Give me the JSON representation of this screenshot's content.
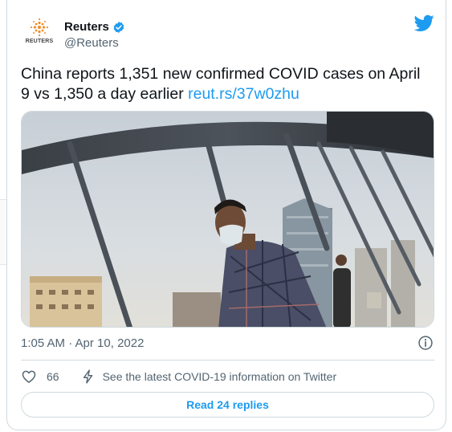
{
  "author": {
    "display_name": "Reuters",
    "handle": "@Reuters",
    "avatar_text": "REUTERS",
    "verified_icon": "verified-badge-icon"
  },
  "tweet": {
    "text": "China reports 1,351 new confirmed COVID cases on April 9 vs 1,350 a day earlier ",
    "link": "reut.rs/37w0zhu",
    "timestamp": "1:05 AM · Apr 10, 2022"
  },
  "actions": {
    "like_count": "66",
    "covid_info": "See the latest COVID-19 information on Twitter"
  },
  "replies": {
    "button_label": "Read 24 replies"
  },
  "colors": {
    "accent": "#1d9bf0",
    "reuters_orange": "#f28c28",
    "secondary_text": "#536471"
  }
}
